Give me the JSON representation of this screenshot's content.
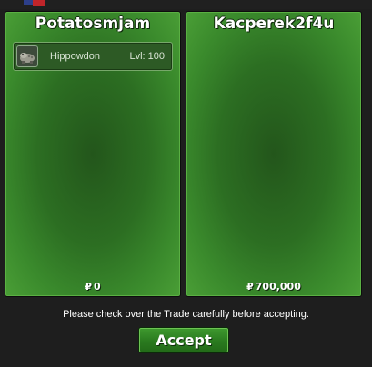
{
  "trade": {
    "left": {
      "player_name": "Potatosmjam",
      "items": [
        {
          "name": "Hippowdon",
          "level": "Lvl: 100",
          "icon": "hippowdon-pokemon-icon"
        }
      ],
      "money_symbol": "₽",
      "money": "0"
    },
    "right": {
      "player_name": "Kacperek2f4u",
      "items": [],
      "money_symbol": "₽",
      "money": "700,000"
    },
    "notice": "Please check over the Trade carefully before accepting.",
    "accept_label": "Accept"
  },
  "colors": {
    "panel_green": "#2c6e22",
    "button_green": "#2a7a1f",
    "background": "#1e1e1e"
  }
}
